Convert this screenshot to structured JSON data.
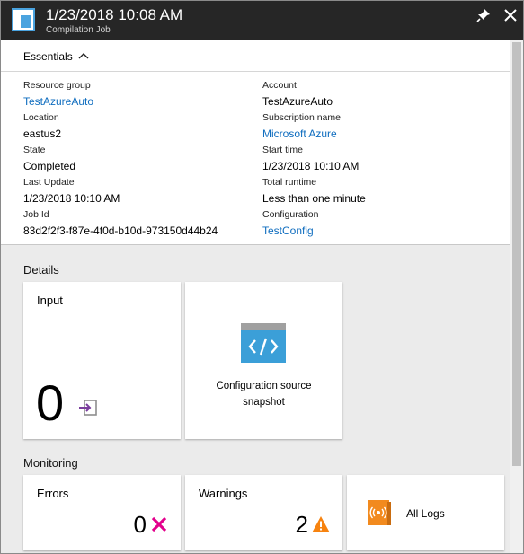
{
  "header": {
    "title": "1/23/2018 10:08 AM",
    "subtitle": "Compilation Job",
    "icon": "blade-icon",
    "pin_icon": "pin-icon",
    "close_icon": "close-icon"
  },
  "essentials": {
    "label": "Essentials",
    "left": [
      {
        "key": "Resource group",
        "value": "TestAzureAuto",
        "link": true
      },
      {
        "key": "Location",
        "value": "eastus2",
        "link": false
      },
      {
        "key": "State",
        "value": "Completed",
        "link": false
      },
      {
        "key": "Last Update",
        "value": "1/23/2018 10:10 AM",
        "link": false
      },
      {
        "key": "Job Id",
        "value": "83d2f2f3-f87e-4f0d-b10d-973150d44b24",
        "link": false
      }
    ],
    "right": [
      {
        "key": "Account",
        "value": "TestAzureAuto",
        "link": false
      },
      {
        "key": "Subscription name",
        "value": "Microsoft Azure",
        "link": true
      },
      {
        "key": "Start time",
        "value": "1/23/2018 10:10 AM",
        "link": false
      },
      {
        "key": "Total runtime",
        "value": "Less than one minute",
        "link": false
      },
      {
        "key": "Configuration",
        "value": "TestConfig",
        "link": true
      }
    ]
  },
  "details": {
    "title": "Details",
    "input_tile": {
      "title": "Input",
      "count": "0",
      "icon": "input-arrow-icon"
    },
    "snapshot_tile": {
      "label_line1": "Configuration source",
      "label_line2": "snapshot",
      "icon": "code-snapshot-icon"
    }
  },
  "monitoring": {
    "title": "Monitoring",
    "errors_tile": {
      "title": "Errors",
      "count": "0",
      "icon": "error-x-icon"
    },
    "warnings_tile": {
      "title": "Warnings",
      "count": "2",
      "icon": "warning-triangle-icon"
    },
    "logs_tile": {
      "label": "All Logs",
      "icon": "logs-book-icon"
    }
  },
  "colors": {
    "header_bg": "#262626",
    "link": "#0f6dbf",
    "error": "#e3008c",
    "warning": "#f7830f",
    "snapshot_blue": "#3b9fd8"
  }
}
